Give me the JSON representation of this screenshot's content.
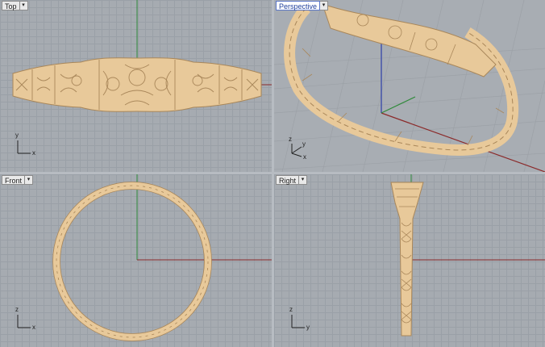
{
  "viewports": {
    "top": {
      "title": "Top",
      "axes": [
        "y",
        "x"
      ]
    },
    "persp": {
      "title": "Perspective",
      "axes": [
        "z",
        "y",
        "x"
      ]
    },
    "front": {
      "title": "Front",
      "axes": [
        "z",
        "x"
      ]
    },
    "right": {
      "title": "Right",
      "axes": [
        "z",
        "y"
      ]
    }
  },
  "menu_glyph": "▾",
  "colors": {
    "model": "#e8c99a",
    "model_dark": "#a9875a",
    "grid": "#9aa0a7",
    "x_axis": "#8b2a2a",
    "y_axis": "#2f8a3a",
    "z_axis": "#2c3fa8"
  }
}
